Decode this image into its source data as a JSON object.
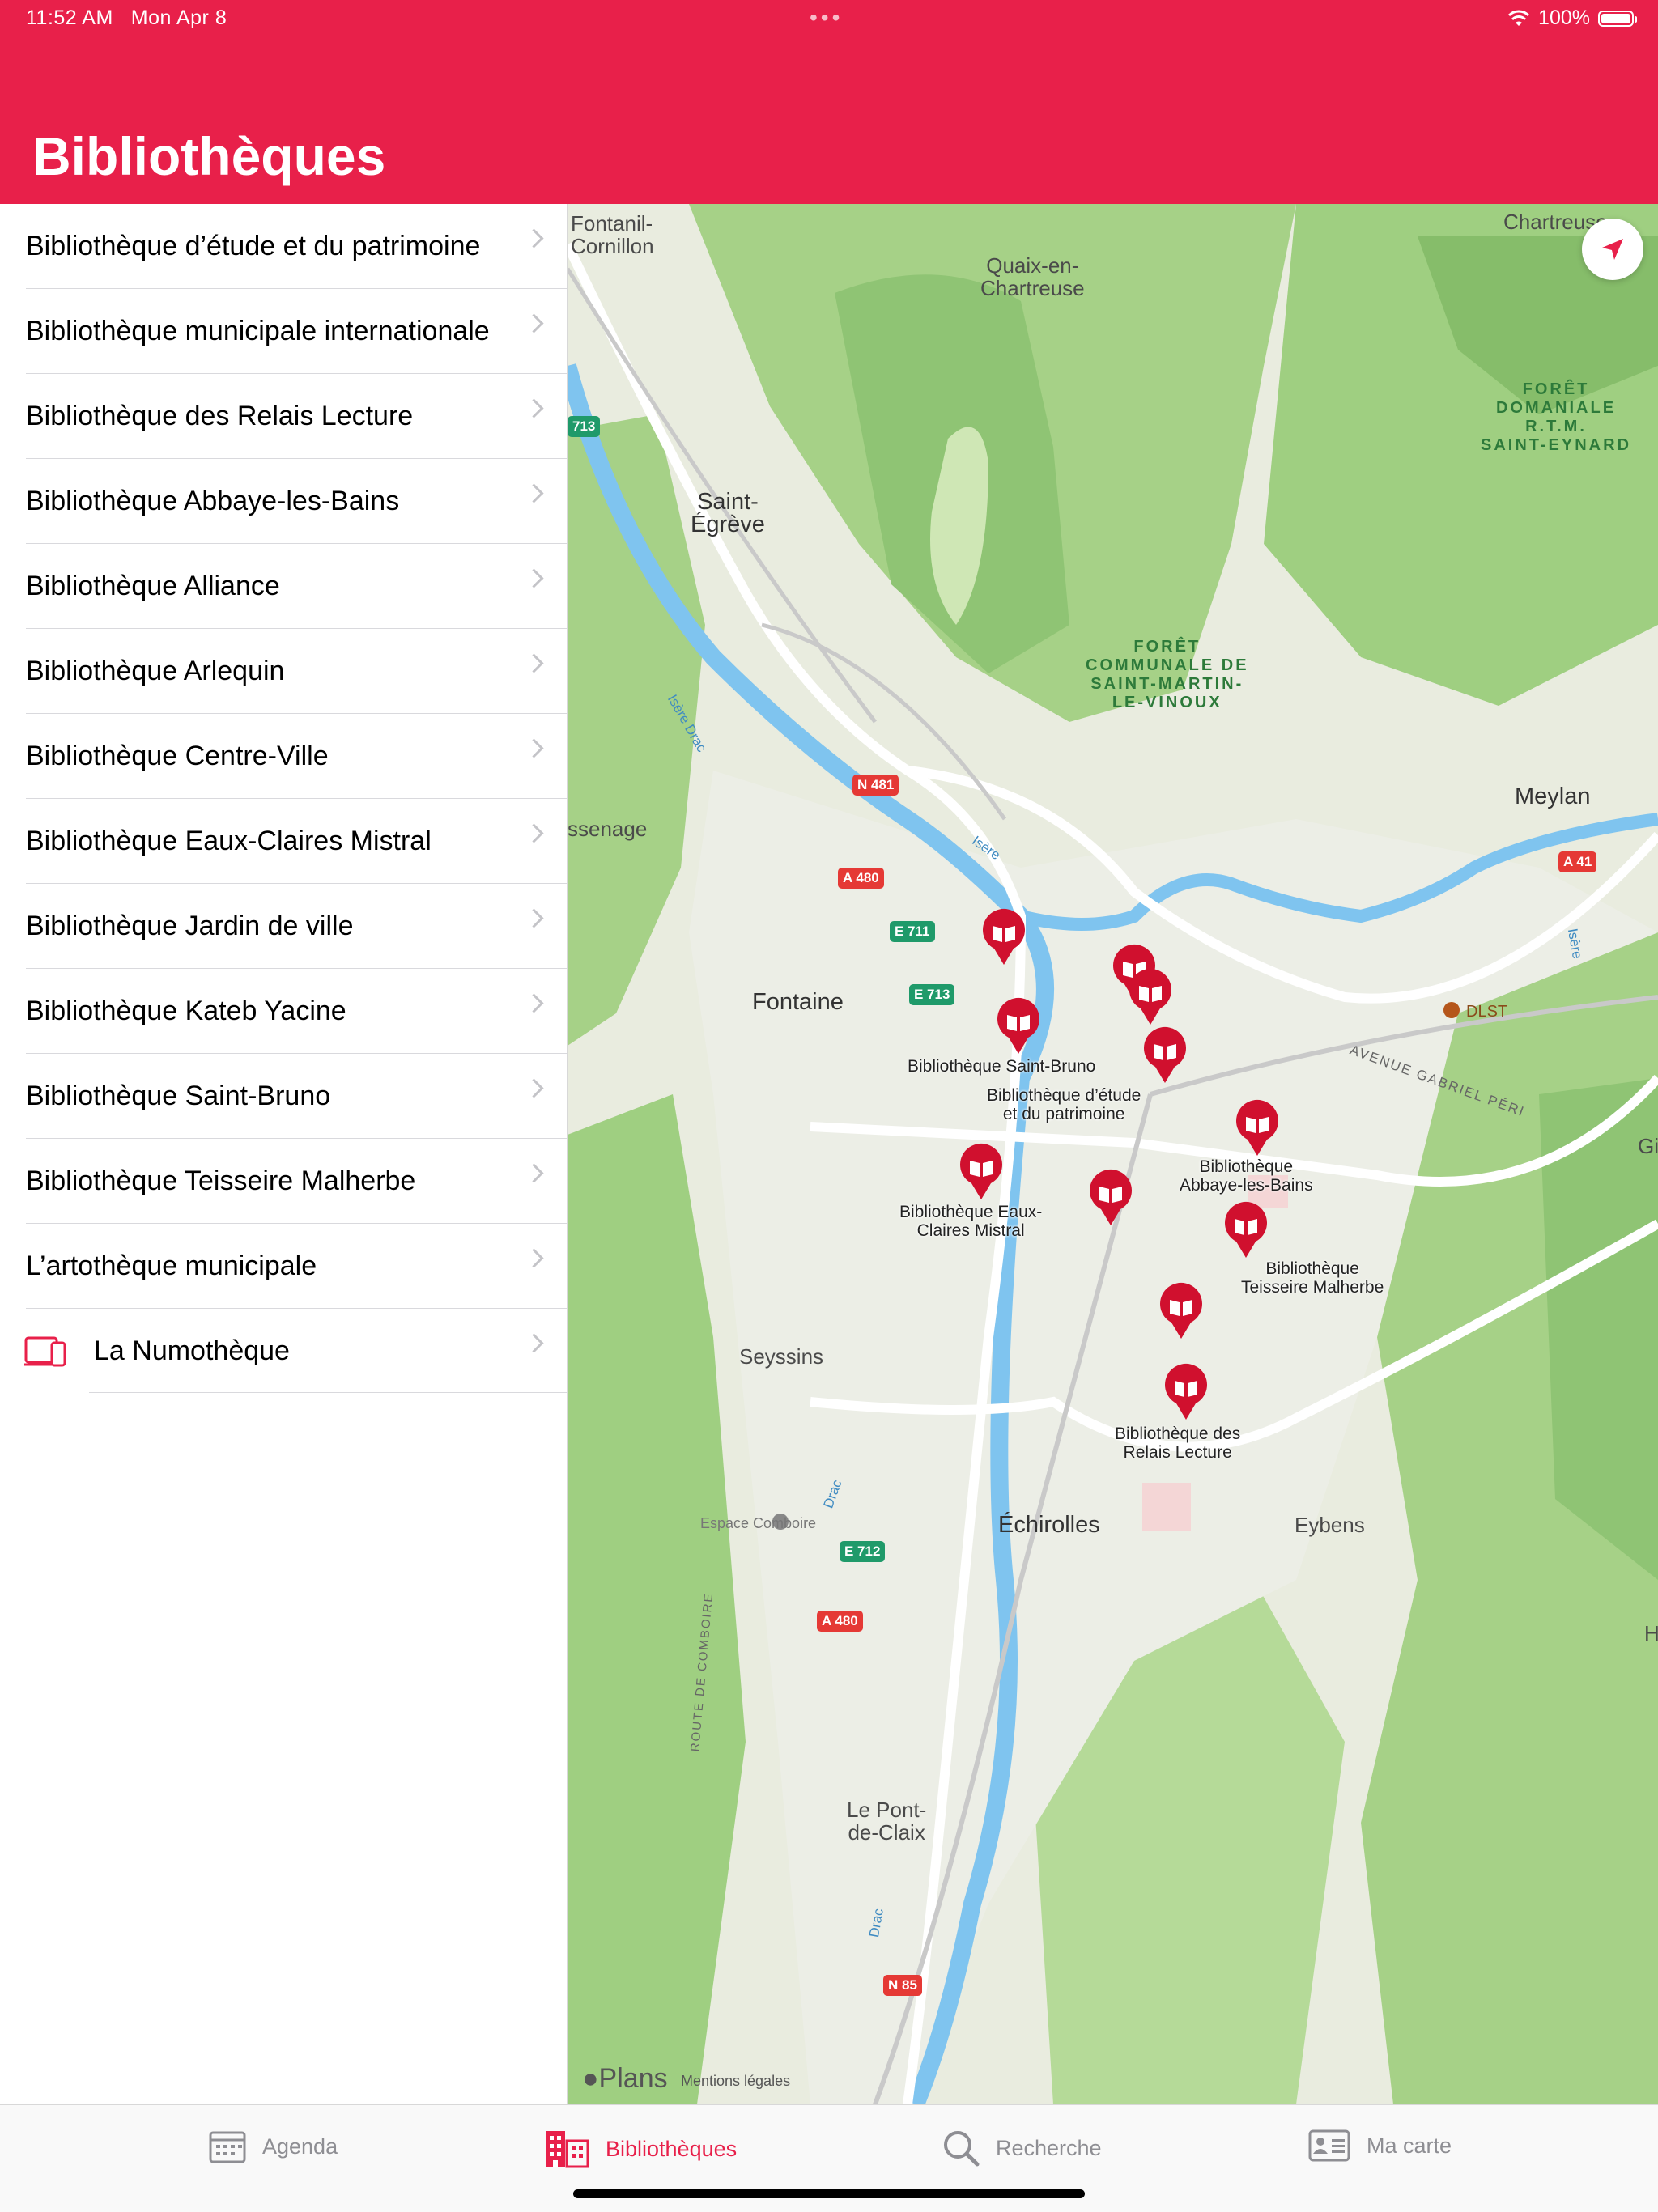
{
  "status": {
    "time": "11:52 AM",
    "date": "Mon Apr 8",
    "battery": "100%"
  },
  "header": {
    "title": "Bibliothèques"
  },
  "list": {
    "items": [
      "Bibliothèque d’étude et du patrimoine",
      "Bibliothèque municipale internationale",
      "Bibliothèque des Relais Lecture",
      "Bibliothèque Abbaye-les-Bains",
      "Bibliothèque Alliance",
      "Bibliothèque Arlequin",
      "Bibliothèque Centre-Ville",
      "Bibliothèque Eaux-Claires Mistral",
      "Bibliothèque Jardin de ville",
      "Bibliothèque Kateb Yacine",
      "Bibliothèque Saint-Bruno",
      "Bibliothèque Teisseire Malherbe",
      "L’artothèque municipale"
    ],
    "numotheque": "La Numothèque"
  },
  "map": {
    "places": {
      "fontanil": "Fontanil-\nCornillon",
      "quaix": "Quaix-en-\nChartreuse",
      "chartreuse": "Chartreuse",
      "saint_egreve": "Saint-\nÉgrève",
      "sassenage": "ssenage",
      "fontaine": "Fontaine",
      "meylan": "Meylan",
      "seyssins": "Seyssins",
      "echirolles": "Échirolles",
      "eybens": "Eybens",
      "pont_de_claix": "Le Pont-\nde-Claix",
      "gi": "Gi",
      "h": "H",
      "espace_comboire": "Espace Comboire",
      "dlst": "DLST",
      "avenue": "AVENUE GABRIEL PÉRI",
      "route_comboire": "ROUTE DE COMBOIRE",
      "isere_drac": "Isère Drac",
      "isere1": "Isère",
      "isere2": "Isère",
      "drac1": "Drac",
      "drac2": "Drac"
    },
    "forests": {
      "saint_eynard": "FORÊT\nDOMANIALE\nR.T.M.\nSAINT-EYNARD",
      "saint_martin": "FORÊT\nCOMMUNALE DE\nSAINT-MARTIN-\nLE-VINOUX"
    },
    "roads": [
      "713",
      "N 481",
      "A 480",
      "E 711",
      "E 713",
      "A 41",
      "E 712",
      "A 480",
      "N 85"
    ],
    "pin_labels": {
      "saint_bruno": "Bibliothèque Saint-Bruno",
      "etude": "Bibliothèque d’étude\net du patrimoine",
      "abbaye": "Bibliothèque\nAbbaye-les-Bains",
      "eaux_claires": "Bibliothèque Eaux-\nClaires Mistral",
      "teisseire": "Bibliothèque\nTeisseire Malherbe",
      "relais": "Bibliothèque des\nRelais Lecture"
    },
    "attribution": "Plans",
    "legal": "Mentions légales"
  },
  "tabs": [
    {
      "label": "Agenda",
      "icon": "calendar-icon"
    },
    {
      "label": "Bibliothèques",
      "icon": "building-icon"
    },
    {
      "label": "Recherche",
      "icon": "search-icon"
    },
    {
      "label": "Ma carte",
      "icon": "id-card-icon"
    }
  ],
  "colors": {
    "accent": "#e8204a",
    "map_green": "#a9d48a",
    "water": "#7fc4ef",
    "road": "#ffffff",
    "pin": "#d0102e"
  }
}
